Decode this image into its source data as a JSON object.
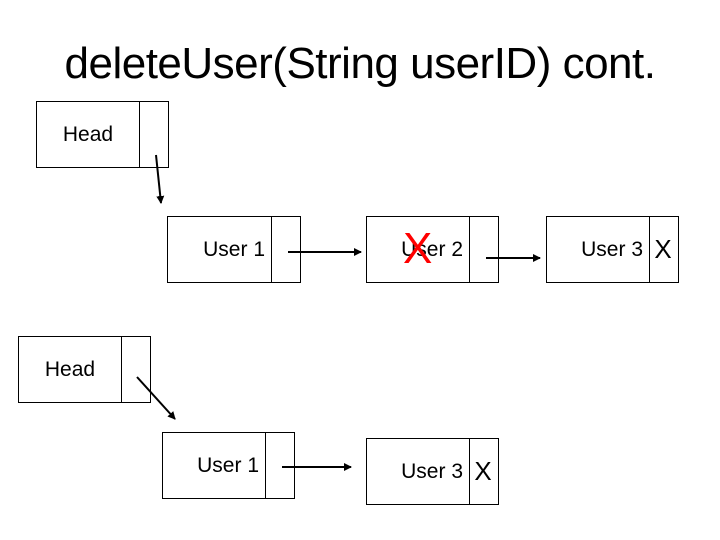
{
  "title": "deleteUser(String userID) cont.",
  "before": {
    "head": {
      "label": "Head",
      "next": ""
    },
    "nodes": [
      {
        "label": "User 1",
        "next": ""
      },
      {
        "label": "User 2",
        "next": "",
        "deleted": true,
        "delete_mark": "X"
      },
      {
        "label": "User 3",
        "next": "X"
      }
    ]
  },
  "after": {
    "head": {
      "label": "Head",
      "next": ""
    },
    "nodes": [
      {
        "label": "User 1",
        "next": ""
      },
      {
        "label": "User 3",
        "next": "X"
      }
    ]
  },
  "colors": {
    "line": "#000000",
    "delete_mark": "#ff0000",
    "background": "#ffffff"
  }
}
